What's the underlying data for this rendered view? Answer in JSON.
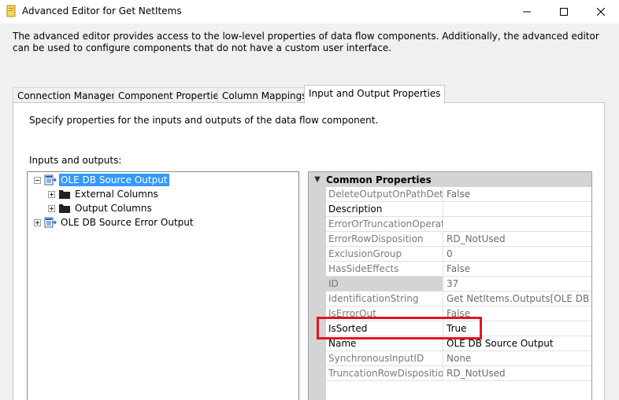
{
  "window": {
    "title": "Advanced Editor for Get NetItems"
  },
  "description": "The advanced editor provides access to the low-level properties of data flow components. Additionally, the advanced editor can be used to configure components that do not have a custom user interface.",
  "tabs": [
    {
      "label": "Connection Managers",
      "active": false
    },
    {
      "label": "Component Properties",
      "active": false
    },
    {
      "label": "Column Mappings",
      "active": false
    },
    {
      "label": "Input and Output Properties",
      "active": true
    }
  ],
  "panel": {
    "description": "Specify properties for the inputs and outputs of the data flow component.",
    "inputs_outputs_label": "Inputs and outputs:"
  },
  "tree": {
    "items": [
      {
        "label": "OLE DB Source Output",
        "expander": "minus",
        "icon": "output-icon",
        "selected": true
      },
      {
        "label": "External Columns",
        "expander": "plus",
        "icon": "folder-icon",
        "selected": false
      },
      {
        "label": "Output Columns",
        "expander": "plus",
        "icon": "folder-icon",
        "selected": false
      },
      {
        "label": "OLE DB Source Error Output",
        "expander": "plus",
        "icon": "output-icon",
        "selected": false
      }
    ]
  },
  "property_grid": {
    "category": "Common Properties",
    "rows": [
      {
        "name": "DeleteOutputOnPathDetach",
        "value": "False",
        "enabled": false
      },
      {
        "name": "Description",
        "value": "",
        "enabled": true
      },
      {
        "name": "ErrorOrTruncationOperation",
        "value": "",
        "enabled": false
      },
      {
        "name": "ErrorRowDisposition",
        "value": "RD_NotUsed",
        "enabled": false
      },
      {
        "name": "ExclusionGroup",
        "value": "0",
        "enabled": false
      },
      {
        "name": "HasSideEffects",
        "value": "False",
        "enabled": false
      },
      {
        "name": "ID",
        "value": "37",
        "enabled": false
      },
      {
        "name": "IdentificationString",
        "value": "Get NetItems.Outputs[OLE DB Source Output]",
        "enabled": false
      },
      {
        "name": "IsErrorOut",
        "value": "False",
        "enabled": false
      },
      {
        "name": "IsSorted",
        "value": "True",
        "enabled": true
      },
      {
        "name": "Name",
        "value": "OLE DB Source Output",
        "enabled": true
      },
      {
        "name": "SynchronousInputID",
        "value": "None",
        "enabled": false
      },
      {
        "name": "TruncationRowDisposition",
        "value": "RD_NotUsed",
        "enabled": false
      }
    ]
  },
  "colors": {
    "selection": "#3399ff",
    "highlight": "#e0161f",
    "category_bg": "#d4d4d4"
  }
}
